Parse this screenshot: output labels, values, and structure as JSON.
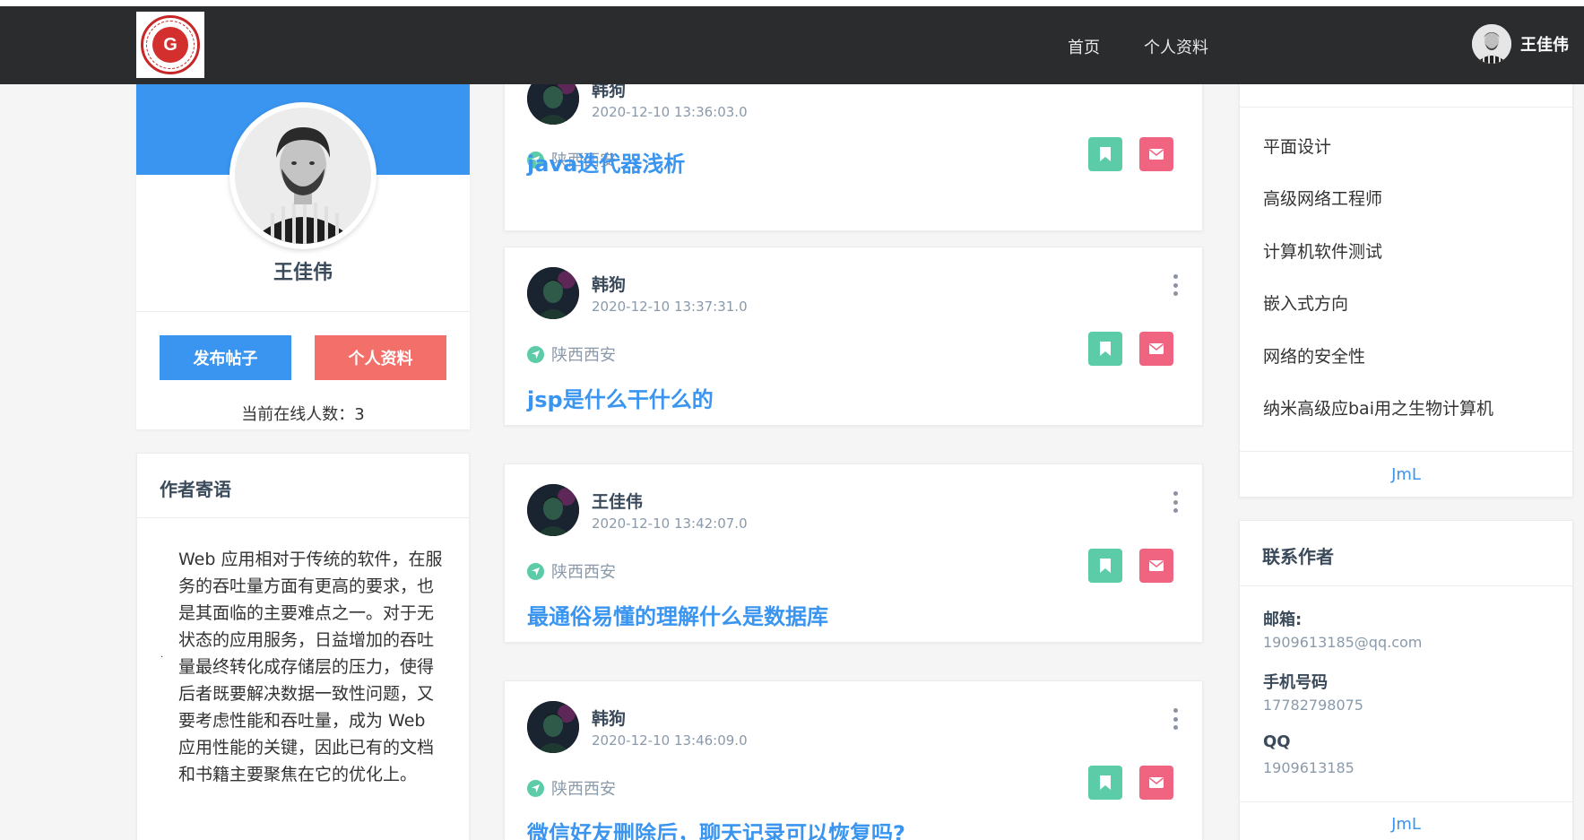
{
  "nav": {
    "logo_text": "G",
    "links": [
      "首页",
      "个人资料"
    ],
    "username": "王佳伟"
  },
  "profile": {
    "name": "王佳伟",
    "post_button": "发布帖子",
    "profile_button": "个人资料",
    "online_text": "当前在线人数：3"
  },
  "note": {
    "title": "作者寄语",
    "dot": "·",
    "text": "Web 应用相对于传统的软件，在服务的吞吐量方面有更高的要求，也是其面临的主要难点之一。对于无状态的应用服务，日益增加的吞吐量最终转化成存储层的压力，使得后者既要解决数据一致性问题，又要考虑性能和吞吐量，成为 Web 应用性能的关键，因此已有的文档和书籍主要聚焦在它的优化上。"
  },
  "posts": [
    {
      "author": "韩狗",
      "time": "2020-12-10 13:36:03.0",
      "location": "陕西西安",
      "title": "java迭代器浅析"
    },
    {
      "author": "韩狗",
      "time": "2020-12-10 13:37:31.0",
      "location": "陕西西安",
      "title": "jsp是什么干什么的"
    },
    {
      "author": "王佳伟",
      "time": "2020-12-10 13:42:07.0",
      "location": "陕西西安",
      "title": "最通俗易懂的理解什么是数据库"
    },
    {
      "author": "韩狗",
      "time": "2020-12-10 13:46:09.0",
      "location": "陕西西安",
      "title": "微信好友删除后，聊天记录可以恢复吗?"
    }
  ],
  "categories": {
    "items": [
      "平面设计",
      "高级网络工程师",
      "计算机软件测试",
      "嵌入式方向",
      "网络的安全性",
      "纳米高级应bai用之生物计算机"
    ],
    "footer": "JmL"
  },
  "contact": {
    "title": "联系作者",
    "email_label": "邮箱:",
    "email": "1909613185@qq.com",
    "phone_label": "手机号码",
    "phone": "17782798075",
    "qq_label": "QQ",
    "qq": "1909613185",
    "footer": "JmL"
  },
  "colors": {
    "navbar": "#2b2c2e",
    "primary": "#3a95f0",
    "danger": "#f26f6a",
    "success": "#5ccba7",
    "mail": "#f06482"
  }
}
